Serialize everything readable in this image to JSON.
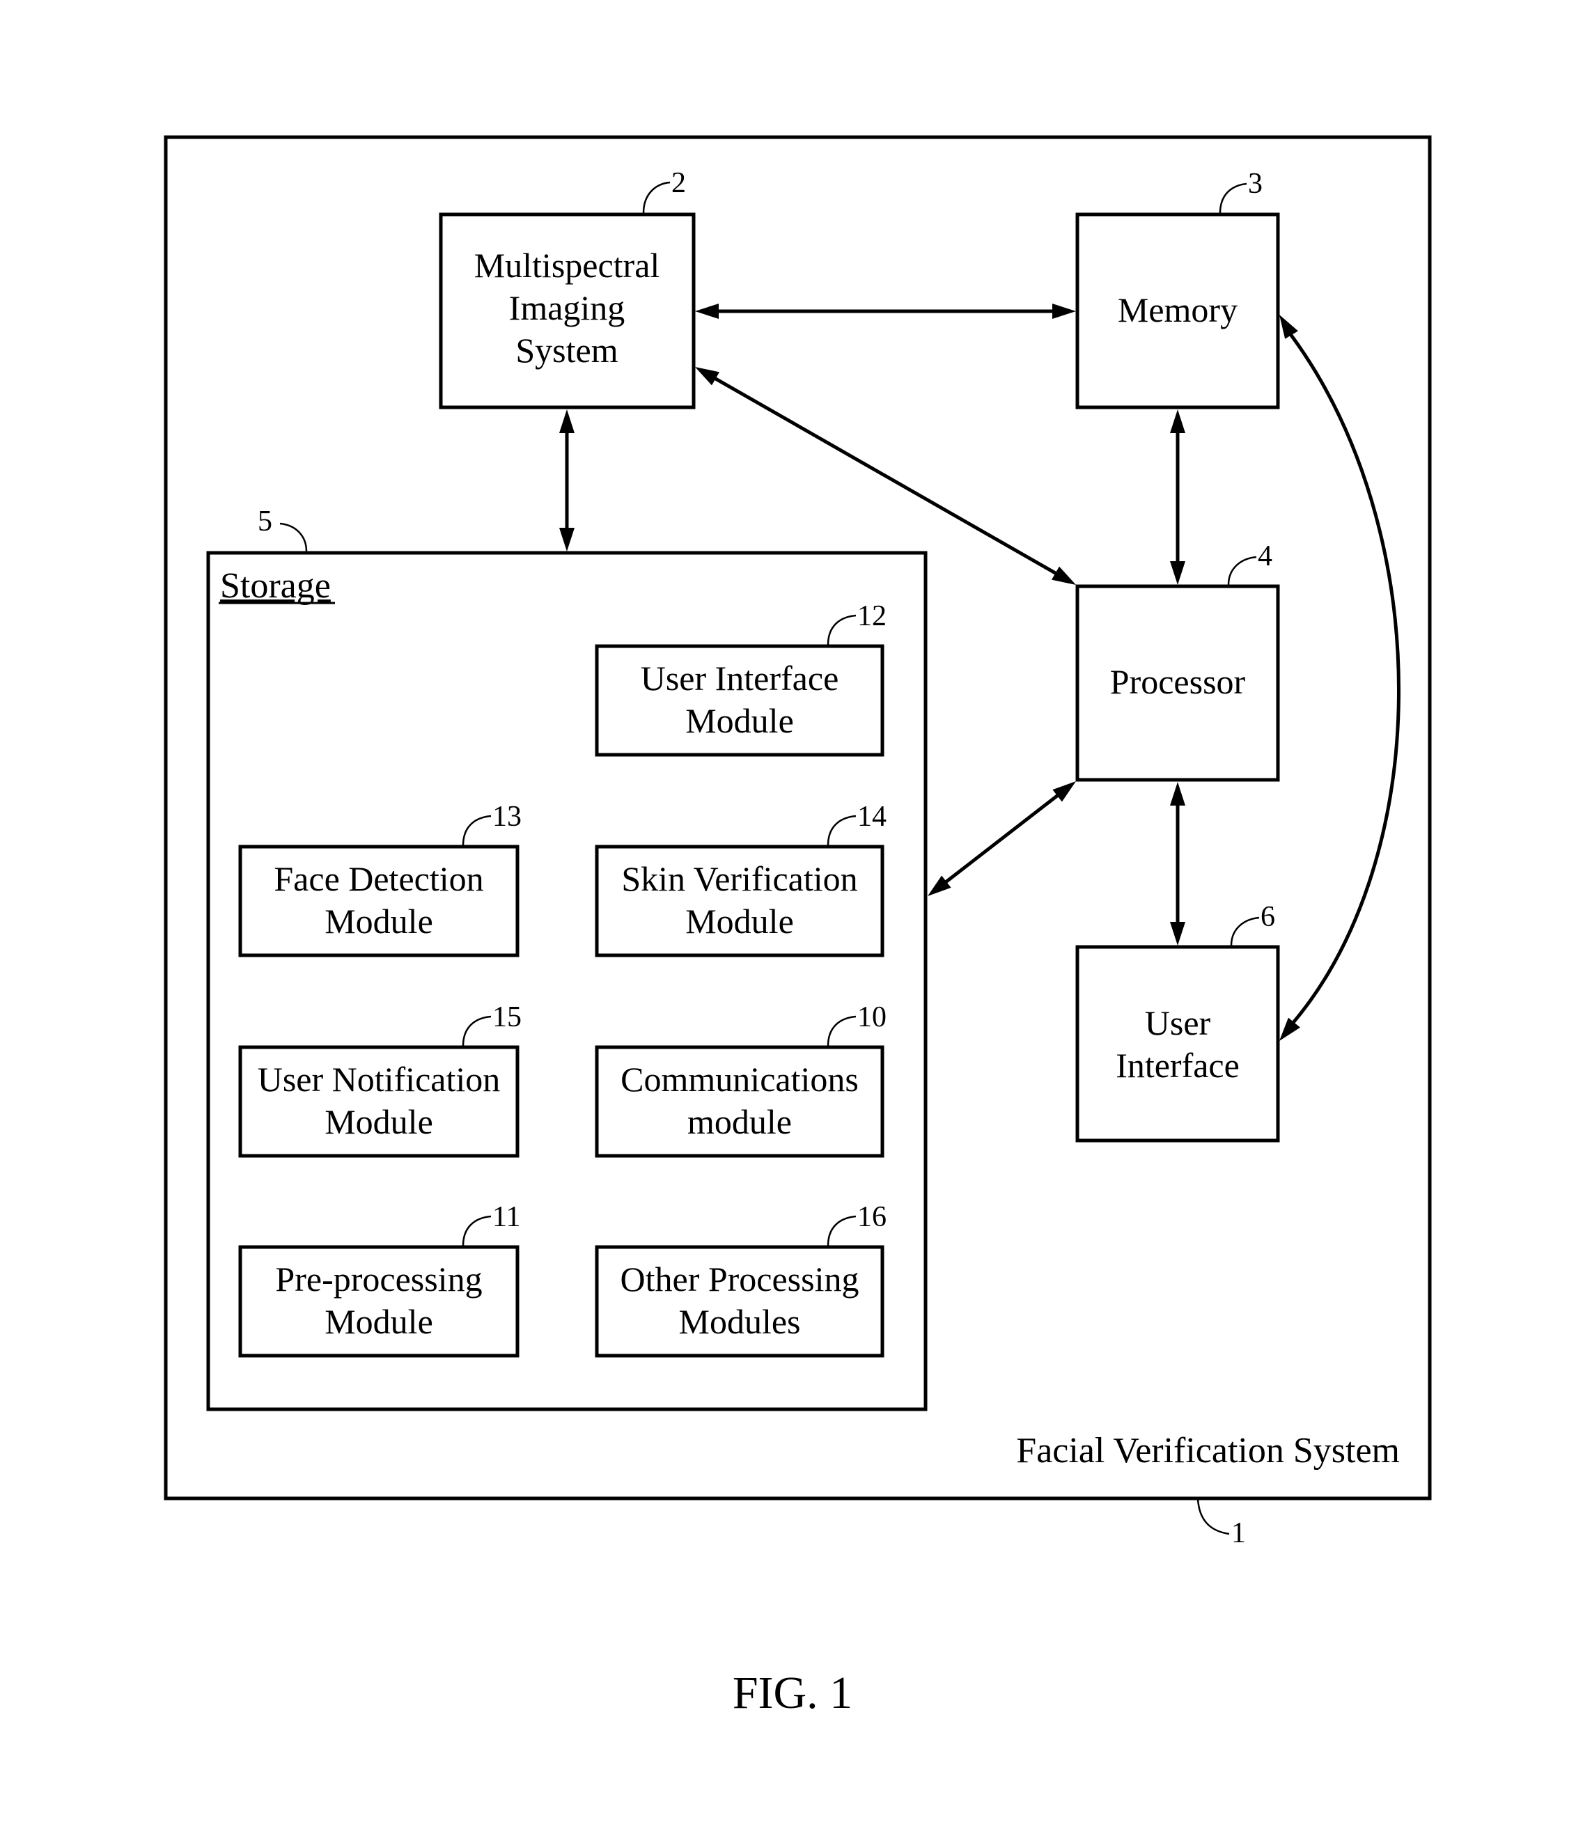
{
  "figure": {
    "caption": "FIG. 1",
    "system": {
      "label": "Facial Verification System",
      "ref": "1"
    }
  },
  "components": {
    "multispectral_imaging_system": {
      "lines": [
        "Multispectral",
        "Imaging",
        "System"
      ],
      "ref": "2"
    },
    "memory": {
      "lines": [
        "Memory"
      ],
      "ref": "3"
    },
    "processor": {
      "lines": [
        "Processor"
      ],
      "ref": "4"
    },
    "storage": {
      "label": "Storage",
      "ref": "5"
    },
    "user_interface": {
      "lines": [
        "User",
        "Interface"
      ],
      "ref": "6"
    }
  },
  "modules": {
    "user_interface_module": {
      "lines": [
        "User Interface",
        "Module"
      ],
      "ref": "12"
    },
    "face_detection_module": {
      "lines": [
        "Face Detection",
        "Module"
      ],
      "ref": "13"
    },
    "skin_verification_module": {
      "lines": [
        "Skin Verification",
        "Module"
      ],
      "ref": "14"
    },
    "user_notification_module": {
      "lines": [
        "User Notification",
        "Module"
      ],
      "ref": "15"
    },
    "communications_module": {
      "lines": [
        "Communications",
        "module"
      ],
      "ref": "10"
    },
    "preprocessing_module": {
      "lines": [
        "Pre-processing",
        "Module"
      ],
      "ref": "11"
    },
    "other_processing_modules": {
      "lines": [
        "Other Processing",
        "Modules"
      ],
      "ref": "16"
    }
  },
  "connections": [
    {
      "from": "multispectral_imaging_system",
      "to": "memory",
      "direction": "bidirectional"
    },
    {
      "from": "multispectral_imaging_system",
      "to": "processor",
      "direction": "bidirectional"
    },
    {
      "from": "multispectral_imaging_system",
      "to": "storage",
      "direction": "bidirectional"
    },
    {
      "from": "memory",
      "to": "processor",
      "direction": "bidirectional"
    },
    {
      "from": "memory",
      "to": "user_interface",
      "direction": "bidirectional"
    },
    {
      "from": "processor",
      "to": "storage",
      "direction": "bidirectional"
    },
    {
      "from": "processor",
      "to": "user_interface",
      "direction": "bidirectional"
    }
  ]
}
